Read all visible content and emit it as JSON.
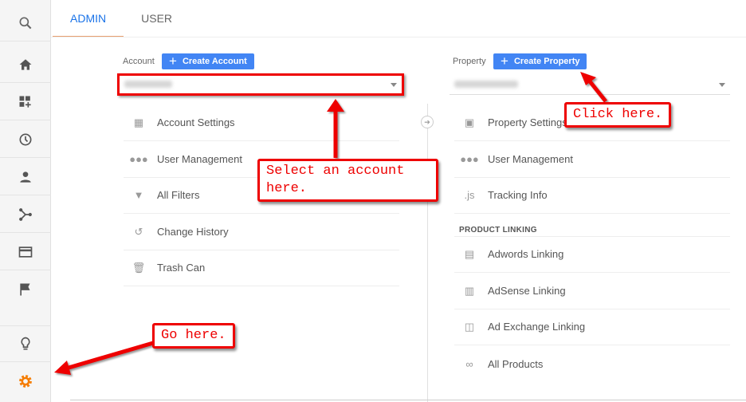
{
  "tabs": [
    {
      "label": "ADMIN",
      "active": true
    },
    {
      "label": "USER",
      "active": false
    }
  ],
  "sidebar": {
    "items": [
      "search-icon",
      "home-icon",
      "dashboard-add-icon",
      "clock-icon",
      "person-icon",
      "branch-icon",
      "window-icon",
      "flag-icon",
      "lightbulb-icon",
      "gear-icon"
    ],
    "accent": "#f57c00"
  },
  "account": {
    "label": "Account",
    "create_label": "Create Account",
    "selected": "",
    "items": [
      {
        "icon": "building-icon",
        "label": "Account Settings"
      },
      {
        "icon": "people-icon",
        "label": "User Management"
      },
      {
        "icon": "filter-icon",
        "label": "All Filters"
      },
      {
        "icon": "history-icon",
        "label": "Change History"
      },
      {
        "icon": "trash-icon",
        "label": "Trash Can"
      }
    ]
  },
  "property": {
    "label": "Property",
    "create_label": "Create Property",
    "selected": "",
    "items": [
      {
        "icon": "layout-icon",
        "label": "Property Settings"
      },
      {
        "icon": "people-icon",
        "label": "User Management"
      },
      {
        "icon": "js-icon",
        "glyph": ".js",
        "label": "Tracking Info"
      }
    ],
    "section": "PRODUCT LINKING",
    "linking": [
      {
        "icon": "adwords-icon",
        "label": "Adwords Linking"
      },
      {
        "icon": "adsense-icon",
        "label": "AdSense Linking"
      },
      {
        "icon": "adexchange-icon",
        "label": "Ad Exchange Linking"
      },
      {
        "icon": "link-icon",
        "label": "All Products"
      }
    ]
  },
  "annotations": {
    "select_account": "Select an account here.",
    "click_here": "Click here.",
    "go_here": "Go here."
  },
  "colors": {
    "primary": "#4285f4",
    "annotation": "#ee0000"
  }
}
